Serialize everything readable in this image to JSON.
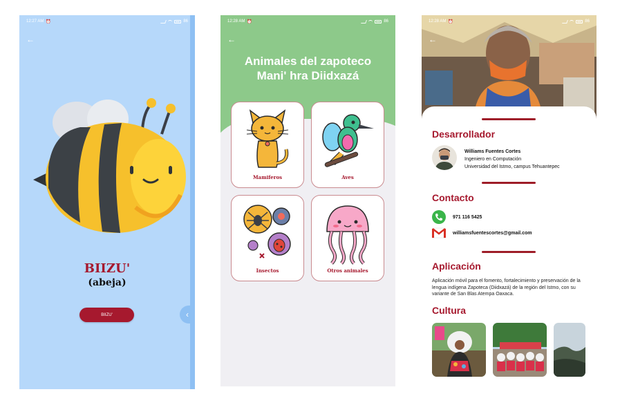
{
  "screen1": {
    "status_time": "12:27 AM",
    "status_battery": "86",
    "animal_name": "BIIZU'",
    "animal_translation": "(abeja)",
    "play_button_label": "BIIZU'"
  },
  "screen2": {
    "status_time": "12:28 AM",
    "status_battery": "86",
    "title_line1": "Animales del zapoteco",
    "title_line2": "Mani' hra Diidxazá",
    "categories": [
      {
        "label": "Mamiferos",
        "icon": "cat-icon"
      },
      {
        "label": "Aves",
        "icon": "bird-icon"
      },
      {
        "label": "Insectos",
        "icon": "insects-icon"
      },
      {
        "label": "Otros animales",
        "icon": "jellyfish-icon"
      }
    ],
    "colors": {
      "header": "#8dc98a",
      "accent": "#a6192e"
    }
  },
  "screen3": {
    "status_time": "12:28 AM",
    "status_battery": "86",
    "developer_title": "Desarrollador",
    "developer": {
      "name": "Williams Fuentes Cortes",
      "degree": "Ingeniero en Computación",
      "institution": "Universidad del Istmo, campus Tehuantepec"
    },
    "contact_title": "Contacto",
    "phone": "971 116 5425",
    "email": "williamsfuentescortes@gmail.com",
    "app_title": "Aplicación",
    "app_description": "Aplicación móvil para el fomento, fortalecimiento y preservación de la lengua indígena Zapoteca (Diidxazá) de la región del Istmo, con su variante de San Blas Atempa Oaxaca.",
    "culture_title": "Cultura"
  }
}
